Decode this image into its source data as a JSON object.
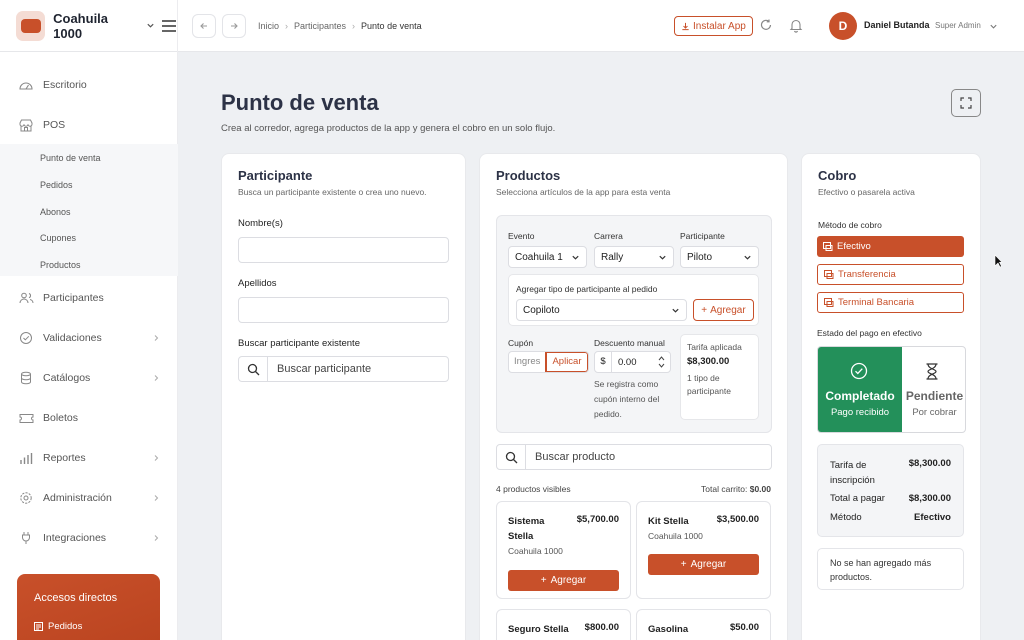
{
  "brand": {
    "name": "Coahuila 1000"
  },
  "breadcrumb": [
    "Inicio",
    "Participantes",
    "Punto de venta"
  ],
  "header": {
    "install_label": "Instalar App",
    "user_initial": "D",
    "user_name": "Daniel Butanda",
    "user_role": "Super Admin"
  },
  "sidebar": {
    "items": [
      {
        "label": "Escritorio",
        "icon": "dashboard-icon"
      },
      {
        "label": "POS",
        "icon": "store-icon"
      },
      {
        "label": "Participantes",
        "icon": "users-icon"
      },
      {
        "label": "Validaciones",
        "icon": "check-circle-icon"
      },
      {
        "label": "Catálogos",
        "icon": "database-icon"
      },
      {
        "label": "Boletos",
        "icon": "ticket-icon"
      },
      {
        "label": "Reportes",
        "icon": "bar-chart-icon"
      },
      {
        "label": "Administración",
        "icon": "gear-icon"
      },
      {
        "label": "Integraciones",
        "icon": "plug-icon"
      }
    ],
    "pos_sub": [
      "Punto de venta",
      "Pedidos",
      "Abonos",
      "Cupones",
      "Productos"
    ],
    "quick_title": "Accesos directos",
    "quick_items": [
      "Pedidos"
    ]
  },
  "page": {
    "title": "Punto de venta",
    "subtitle": "Crea al corredor, agrega productos de la app y genera el cobro en un solo flujo."
  },
  "participante": {
    "title": "Participante",
    "subtitle": "Busca un participante existente o crea uno nuevo.",
    "nombre_label": "Nombre(s)",
    "apellidos_label": "Apellidos",
    "buscar_label": "Buscar participante existente",
    "buscar_placeholder": "Buscar participante"
  },
  "productos": {
    "title": "Productos",
    "subtitle": "Selecciona artículos de la app para esta venta",
    "evento_label": "Evento",
    "evento_value": "Coahuila 1",
    "carrera_label": "Carrera",
    "carrera_value": "Rally",
    "participante_label": "Participante",
    "participante_value": "Piloto",
    "tipo_label": "Agregar tipo de participante al pedido",
    "tipo_value": "Copiloto",
    "agregar_label": "Agregar",
    "cupon_label": "Cupón",
    "cupon_placeholder": "Ingres",
    "aplicar_label": "Aplicar",
    "descuento_label": "Descuento manual",
    "descuento_currency": "$",
    "descuento_value": "0.00",
    "descuento_note": "Se registra como cupón interno del pedido.",
    "tarifa_label": "Tarifa aplicada",
    "tarifa_value": "$8,300.00",
    "tarifa_note": "1 tipo de participante",
    "search_placeholder": "Buscar producto",
    "visible_count": "4 productos visibles",
    "total_label": "Total carrito:",
    "total_value": "$0.00",
    "items": [
      {
        "name": "Sistema Stella",
        "price": "$5,700.00",
        "event": "Coahuila 1000",
        "button": "Agregar"
      },
      {
        "name": "Kit Stella",
        "price": "$3,500.00",
        "event": "Coahuila 1000",
        "button": "Agregar"
      },
      {
        "name": "Seguro Stella",
        "price": "$800.00"
      },
      {
        "name": "Gasolina",
        "price": "$50.00"
      }
    ]
  },
  "cobro": {
    "title": "Cobro",
    "subtitle": "Efectivo o pasarela activa",
    "metodo_label": "Método de cobro",
    "metodos": [
      "Efectivo",
      "Transferencia",
      "Terminal Bancaria"
    ],
    "estado_label": "Estado del pago en efectivo",
    "completado": {
      "title": "Completado",
      "sub": "Pago recibido"
    },
    "pendiente": {
      "title": "Pendiente",
      "sub": "Por cobrar"
    },
    "resumen": [
      {
        "label": "Tarifa de inscripción",
        "value": "$8,300.00"
      },
      {
        "label": "Total a pagar",
        "value": "$8,300.00"
      },
      {
        "label": "Método",
        "value": "Efectivo"
      }
    ],
    "nota": "No se han agregado más productos."
  },
  "colors": {
    "accent": "#c8502a",
    "success": "#23905a"
  }
}
